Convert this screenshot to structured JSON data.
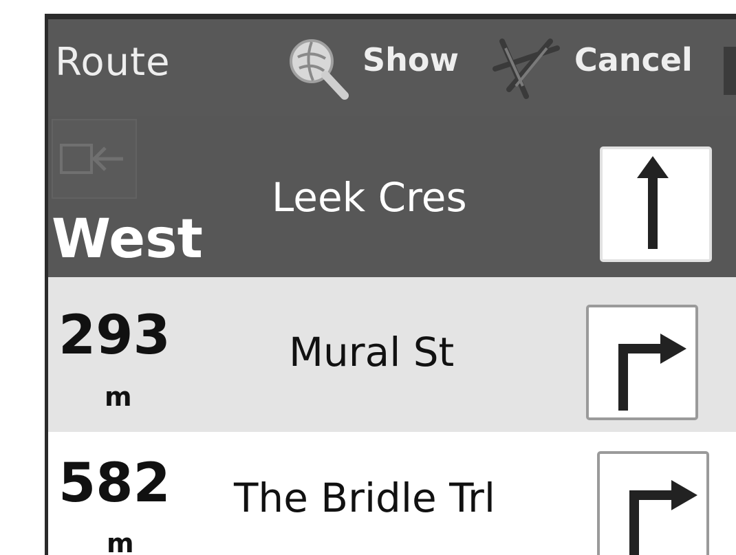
{
  "toolbar": {
    "title": "Route",
    "show_label": "Show",
    "cancel_label": "Cancel",
    "show_icon": "magnifier-globe-icon",
    "cancel_icon": "route-cancel-icon"
  },
  "current": {
    "back_icon": "back-arrow-icon",
    "direction": "West",
    "street": "Leek Cres",
    "maneuver_icon": "straight-arrow-icon"
  },
  "instructions": [
    {
      "distance": "293",
      "unit": "m",
      "street": "Mural St",
      "maneuver_icon": "turn-right-arrow-icon"
    },
    {
      "distance": "582",
      "unit": "m",
      "street": "The Bridle Trl",
      "maneuver_icon": "turn-right-arrow-icon"
    }
  ],
  "colors": {
    "toolbar_bg": "#585858",
    "header_bg": "#575757",
    "row_alt_bg": "#e4e4e4",
    "row_bg": "#ffffff"
  }
}
